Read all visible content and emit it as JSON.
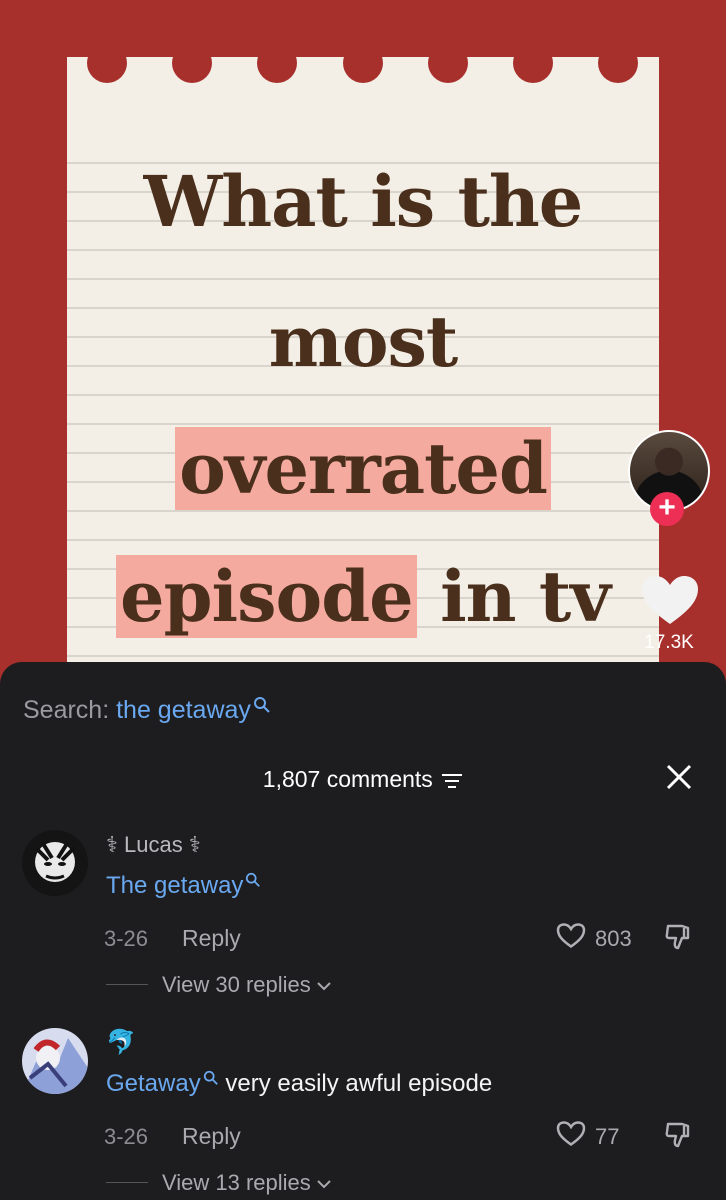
{
  "video": {
    "title_lines": [
      "What is the",
      "most"
    ],
    "title_line3": "overrated",
    "title_line4_hl": "episode",
    "title_line4_rest": " in tv",
    "like_count": "17.3K",
    "follow_symbol": "+"
  },
  "sheet": {
    "search_prefix": "Search: ",
    "search_term": "the getaway",
    "comment_count": "1,807 comments"
  },
  "comments": [
    {
      "username": "Lucas",
      "text_link": "The getaway",
      "text_rest": "",
      "date": "3-26",
      "reply_label": "Reply",
      "likes": "803",
      "view_replies": "View 30 replies"
    },
    {
      "username": "🐬",
      "text_link": "Getaway",
      "text_rest": " very easily awful episode",
      "date": "3-26",
      "reply_label": "Reply",
      "likes": "77",
      "view_replies": "View 13 replies"
    }
  ],
  "colors": {
    "accent_link": "#6aa8f0",
    "follow_red": "#ee2f55",
    "video_bg": "#a8302c",
    "highlight": "#f5aaa0"
  },
  "icons": [
    "search-icon",
    "heart-icon",
    "dislike-icon",
    "close-icon",
    "filter-icon",
    "chevron-down-icon",
    "plus-icon"
  ]
}
